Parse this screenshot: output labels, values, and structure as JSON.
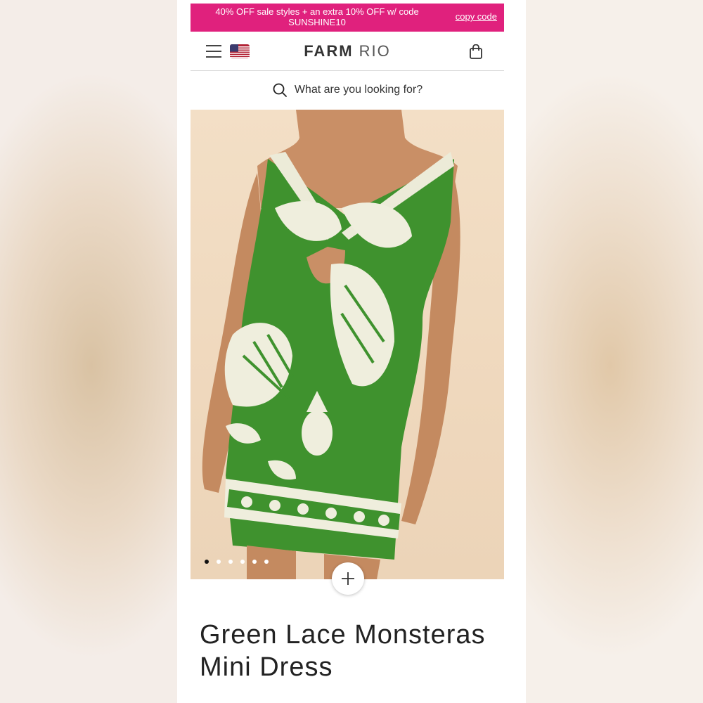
{
  "promo": {
    "text": "40% OFF sale styles + an extra 10% OFF w/ code SUNSHINE10",
    "link": "copy code"
  },
  "header": {
    "logo_bold": "FARM",
    "logo_light": "RIO",
    "menu_icon": "hamburger-icon",
    "flag_icon": "us-flag-icon",
    "bag_icon": "shopping-bag-icon"
  },
  "search": {
    "placeholder": "What are you looking for?",
    "icon": "search-icon"
  },
  "product": {
    "title": "Green Lace Monsteras Mini Dress",
    "image_count": 6,
    "active_image": 1
  },
  "colors": {
    "promo_bg": "#e0217d",
    "dress_green": "#3b8f2c",
    "print_cream": "#efeedd"
  }
}
